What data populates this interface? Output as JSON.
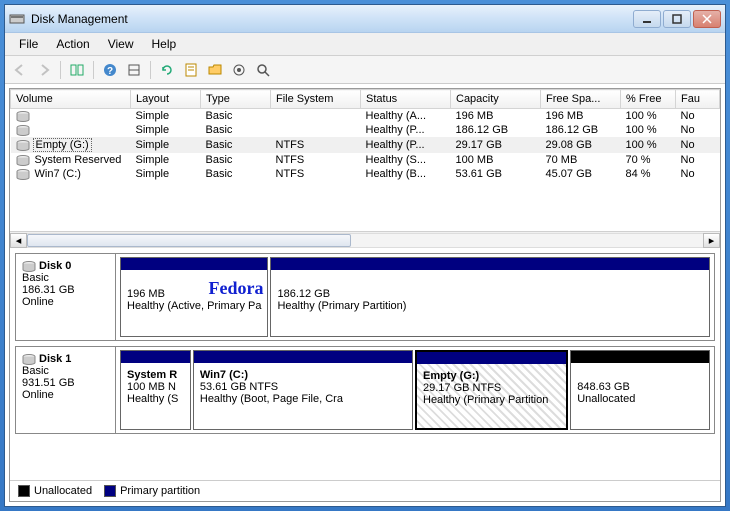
{
  "window": {
    "title": "Disk Management"
  },
  "menubar": {
    "file": "File",
    "action": "Action",
    "view": "View",
    "help": "Help"
  },
  "columns": {
    "volume": "Volume",
    "layout": "Layout",
    "type": "Type",
    "filesystem": "File System",
    "status": "Status",
    "capacity": "Capacity",
    "freespace": "Free Spa...",
    "pctfree": "% Free",
    "fault": "Fau"
  },
  "volumes": [
    {
      "name": "",
      "layout": "Simple",
      "type": "Basic",
      "fs": "",
      "status": "Healthy (A...",
      "capacity": "196 MB",
      "free": "196 MB",
      "pct": "100 %",
      "fault": "No",
      "selected": false
    },
    {
      "name": "",
      "layout": "Simple",
      "type": "Basic",
      "fs": "",
      "status": "Healthy (P...",
      "capacity": "186.12 GB",
      "free": "186.12 GB",
      "pct": "100 %",
      "fault": "No",
      "selected": false
    },
    {
      "name": "Empty (G:)",
      "layout": "Simple",
      "type": "Basic",
      "fs": "NTFS",
      "status": "Healthy (P...",
      "capacity": "29.17 GB",
      "free": "29.08 GB",
      "pct": "100 %",
      "fault": "No",
      "selected": true
    },
    {
      "name": "System Reserved",
      "layout": "Simple",
      "type": "Basic",
      "fs": "NTFS",
      "status": "Healthy (S...",
      "capacity": "100 MB",
      "free": "70 MB",
      "pct": "70 %",
      "fault": "No",
      "selected": false
    },
    {
      "name": "Win7 (C:)",
      "layout": "Simple",
      "type": "Basic",
      "fs": "NTFS",
      "status": "Healthy (B...",
      "capacity": "53.61 GB",
      "free": "45.07 GB",
      "pct": "84 %",
      "fault": "No",
      "selected": false
    }
  ],
  "disks": [
    {
      "name": "Disk 0",
      "type": "Basic",
      "size": "186.31 GB",
      "status": "Online",
      "partitions": [
        {
          "label": "",
          "size": "196 MB",
          "detail": "Healthy (Active, Primary Pa",
          "kind": "primary",
          "flex": 20,
          "annotation": "Fedora"
        },
        {
          "label": "",
          "size": "186.12 GB",
          "detail": "Healthy (Primary Partition)",
          "kind": "primary",
          "flex": 80
        }
      ]
    },
    {
      "name": "Disk 1",
      "type": "Basic",
      "size": "931.51 GB",
      "status": "Online",
      "partitions": [
        {
          "label": "System R",
          "size": "100 MB N",
          "detail": "Healthy (S",
          "kind": "primary",
          "flex": 12
        },
        {
          "label": "Win7  (C:)",
          "size": "53.61 GB NTFS",
          "detail": "Healthy (Boot, Page File, Cra",
          "kind": "primary",
          "flex": 38
        },
        {
          "label": "Empty  (G:)",
          "size": "29.17 GB NTFS",
          "detail": "Healthy (Primary Partition",
          "kind": "primary",
          "flex": 26,
          "hatched": true,
          "selected": true
        },
        {
          "label": "",
          "size": "848.63 GB",
          "detail": "Unallocated",
          "kind": "unalloc",
          "flex": 24
        }
      ]
    }
  ],
  "legend": {
    "unallocated": "Unallocated",
    "primary": "Primary partition"
  }
}
